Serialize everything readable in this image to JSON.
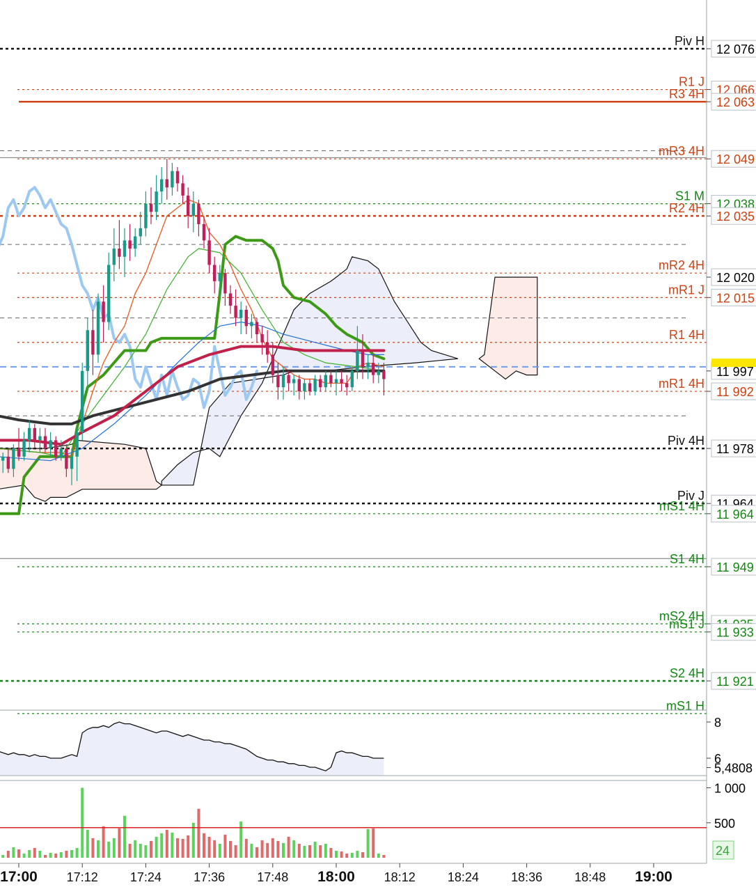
{
  "chart_data": {
    "type": "candlestick",
    "title": "",
    "price_axis": {
      "range": [
        11912,
        12085
      ],
      "tick_labels": [
        {
          "value": 12076,
          "text": "12 076",
          "color": "#000000",
          "box": "#ffffff"
        },
        {
          "value": 12066,
          "text": "12 066",
          "color": "#d04010",
          "box": "#ffffff"
        },
        {
          "value": 12063,
          "text": "12 063",
          "color": "#d04010",
          "box": "#ffffff"
        },
        {
          "value": 12049,
          "text": "12 049",
          "color": "#d04010",
          "box": "#ffffff"
        },
        {
          "value": 12038,
          "text": "12 038",
          "color": "#118811",
          "box": "#ffffff"
        },
        {
          "value": 12035,
          "text": "12 035",
          "color": "#d04010",
          "box": "#ffffff"
        },
        {
          "value": 12020,
          "text": "12 020",
          "color": "#000000",
          "box": "#ffffff"
        },
        {
          "value": 12015,
          "text": "12 015",
          "color": "#d04010",
          "box": "#ffffff"
        },
        {
          "value": 11997,
          "text": "11 997",
          "color": "#000000",
          "box": "#ffffff"
        },
        {
          "value": 11992,
          "text": "11 992",
          "color": "#d04010",
          "box": "#ffffff"
        },
        {
          "value": 11978,
          "text": "11 978",
          "color": "#000000",
          "box": "#ffffff"
        },
        {
          "value": 11964.5,
          "text": "11 964",
          "color": "#000000",
          "box": "#ffffff"
        },
        {
          "value": 11962,
          "text": "11 964",
          "color": "#118811",
          "box": "#ffffff"
        },
        {
          "value": 11949,
          "text": "11 949",
          "color": "#118811",
          "box": "#ffffff"
        },
        {
          "value": 11935,
          "text": "11 935",
          "color": "#118811",
          "box": "#ffffff"
        },
        {
          "value": 11933,
          "text": "11 933",
          "color": "#118811",
          "box": "#ffffff"
        },
        {
          "value": 11921,
          "text": "11 921",
          "color": "#118811",
          "box": "#ffffff"
        }
      ]
    },
    "time_axis": {
      "tick_labels": [
        "17:00",
        "17:12",
        "17:24",
        "17:36",
        "17:48",
        "18:00",
        "18:12",
        "18:24",
        "18:36",
        "18:48",
        "19:00"
      ],
      "bold_labels": [
        "17:00",
        "18:00",
        "19:00"
      ],
      "start": "16:56",
      "end": "19:04"
    },
    "pivot_levels": [
      {
        "label": "Piv H",
        "value": 12076,
        "color": "#111111",
        "style": "dotted-bold"
      },
      {
        "label": "R1 J",
        "value": 12066,
        "color": "#d04010",
        "style": "dotted"
      },
      {
        "label": "R3 4H",
        "value": 12063,
        "color": "#d04010",
        "style": "solid"
      },
      {
        "label": "mR3 4H",
        "value": 12049,
        "color": "#d04010",
        "style": "dotted"
      },
      {
        "label": "S1 M",
        "value": 12038,
        "color": "#118811",
        "style": "dotted"
      },
      {
        "label": "R2 4H",
        "value": 12035,
        "color": "#d04010",
        "style": "dotted-bold"
      },
      {
        "label": "mR2 4H",
        "value": 12021,
        "color": "#d04010",
        "style": "dotted"
      },
      {
        "label": "mR1 J",
        "value": 12015,
        "color": "#d04010",
        "style": "dotted"
      },
      {
        "label": "R1 4H",
        "value": 12004,
        "color": "#d04010",
        "style": "dotted"
      },
      {
        "label": "mR1 4H",
        "value": 11992,
        "color": "#d04010",
        "style": "dotted"
      },
      {
        "label": "Piv 4H",
        "value": 11978,
        "color": "#111111",
        "style": "dotted-bold"
      },
      {
        "label": "Piv J",
        "value": 11964.5,
        "color": "#111111",
        "style": "dotted-bold"
      },
      {
        "label": "mS1 4H",
        "value": 11962,
        "color": "#118811",
        "style": "dotted"
      },
      {
        "label": "S1 4H",
        "value": 11949,
        "color": "#118811",
        "style": "dotted"
      },
      {
        "label": "mS2 4H",
        "value": 11935,
        "color": "#118811",
        "style": "dotted"
      },
      {
        "label": "mS1 J",
        "value": 11933,
        "color": "#118811",
        "style": "dotted"
      },
      {
        "label": "S2 4H",
        "value": 11921,
        "color": "#118811",
        "style": "dotted-bold"
      },
      {
        "label": "mS1 H",
        "value": 11913,
        "color": "#118811",
        "style": "dotted"
      }
    ],
    "candles": [
      {
        "t": "16:56",
        "o": 11978,
        "h": 11979,
        "l": 11973,
        "c": 11975
      },
      {
        "t": "16:57",
        "o": 11975,
        "h": 11977,
        "l": 11972,
        "c": 11976
      },
      {
        "t": "16:58",
        "o": 11976,
        "h": 11978,
        "l": 11972,
        "c": 11973
      },
      {
        "t": "16:59",
        "o": 11973,
        "h": 11979,
        "l": 11971,
        "c": 11978
      },
      {
        "t": "17:00",
        "o": 11978,
        "h": 11983,
        "l": 11975,
        "c": 11976
      },
      {
        "t": "17:01",
        "o": 11976,
        "h": 11982,
        "l": 11975,
        "c": 11980
      },
      {
        "t": "17:02",
        "o": 11980,
        "h": 11985,
        "l": 11977,
        "c": 11983
      },
      {
        "t": "17:03",
        "o": 11983,
        "h": 11984,
        "l": 11978,
        "c": 11980
      },
      {
        "t": "17:04",
        "o": 11980,
        "h": 11983,
        "l": 11977,
        "c": 11981
      },
      {
        "t": "17:05",
        "o": 11981,
        "h": 11983,
        "l": 11977,
        "c": 11978
      },
      {
        "t": "17:06",
        "o": 11978,
        "h": 11982,
        "l": 11976,
        "c": 11980
      },
      {
        "t": "17:07",
        "o": 11980,
        "h": 11981,
        "l": 11975,
        "c": 11976
      },
      {
        "t": "17:08",
        "o": 11976,
        "h": 11980,
        "l": 11975,
        "c": 11978
      },
      {
        "t": "17:09",
        "o": 11978,
        "h": 11979,
        "l": 11971,
        "c": 11973
      },
      {
        "t": "17:10",
        "o": 11973,
        "h": 11978,
        "l": 11969,
        "c": 11976
      },
      {
        "t": "17:11",
        "o": 11976,
        "h": 11983,
        "l": 11970,
        "c": 11982
      },
      {
        "t": "17:12",
        "o": 11982,
        "h": 11999,
        "l": 11980,
        "c": 11997
      },
      {
        "t": "17:13",
        "o": 11997,
        "h": 12010,
        "l": 11992,
        "c": 12007
      },
      {
        "t": "17:14",
        "o": 12007,
        "h": 12012,
        "l": 11996,
        "c": 12001
      },
      {
        "t": "17:15",
        "o": 12001,
        "h": 12016,
        "l": 11999,
        "c": 12014
      },
      {
        "t": "17:16",
        "o": 12014,
        "h": 12018,
        "l": 12004,
        "c": 12009
      },
      {
        "t": "17:17",
        "o": 12009,
        "h": 12026,
        "l": 12007,
        "c": 12023
      },
      {
        "t": "17:18",
        "o": 12023,
        "h": 12032,
        "l": 12019,
        "c": 12027
      },
      {
        "t": "17:19",
        "o": 12027,
        "h": 12034,
        "l": 12022,
        "c": 12025
      },
      {
        "t": "17:20",
        "o": 12025,
        "h": 12032,
        "l": 12020,
        "c": 12029
      },
      {
        "t": "17:21",
        "o": 12029,
        "h": 12033,
        "l": 12024,
        "c": 12027
      },
      {
        "t": "17:22",
        "o": 12027,
        "h": 12032,
        "l": 12025,
        "c": 12030
      },
      {
        "t": "17:23",
        "o": 12030,
        "h": 12036,
        "l": 12028,
        "c": 12032
      },
      {
        "t": "17:24",
        "o": 12032,
        "h": 12041,
        "l": 12030,
        "c": 12038
      },
      {
        "t": "17:25",
        "o": 12038,
        "h": 12042,
        "l": 12033,
        "c": 12036
      },
      {
        "t": "17:26",
        "o": 12036,
        "h": 12045,
        "l": 12034,
        "c": 12041
      },
      {
        "t": "17:27",
        "o": 12041,
        "h": 12047,
        "l": 12038,
        "c": 12044
      },
      {
        "t": "17:28",
        "o": 12044,
        "h": 12049,
        "l": 12039,
        "c": 12042
      },
      {
        "t": "17:29",
        "o": 12042,
        "h": 12048,
        "l": 12040,
        "c": 12046
      },
      {
        "t": "17:30",
        "o": 12046,
        "h": 12047,
        "l": 12041,
        "c": 12043
      },
      {
        "t": "17:31",
        "o": 12043,
        "h": 12045,
        "l": 12038,
        "c": 12040
      },
      {
        "t": "17:32",
        "o": 12040,
        "h": 12042,
        "l": 12032,
        "c": 12035
      },
      {
        "t": "17:33",
        "o": 12035,
        "h": 12041,
        "l": 12031,
        "c": 12038
      },
      {
        "t": "17:34",
        "o": 12038,
        "h": 12039,
        "l": 12030,
        "c": 12033
      },
      {
        "t": "17:35",
        "o": 12033,
        "h": 12035,
        "l": 12027,
        "c": 12029
      },
      {
        "t": "17:36",
        "o": 12029,
        "h": 12032,
        "l": 12021,
        "c": 12023
      },
      {
        "t": "17:37",
        "o": 12023,
        "h": 12025,
        "l": 12016,
        "c": 12019
      },
      {
        "t": "17:38",
        "o": 12019,
        "h": 12023,
        "l": 12015,
        "c": 12021
      },
      {
        "t": "17:39",
        "o": 12021,
        "h": 12022,
        "l": 12013,
        "c": 12016
      },
      {
        "t": "17:40",
        "o": 12016,
        "h": 12018,
        "l": 12011,
        "c": 12013
      },
      {
        "t": "17:41",
        "o": 12013,
        "h": 12017,
        "l": 12008,
        "c": 12010
      },
      {
        "t": "17:42",
        "o": 12010,
        "h": 12014,
        "l": 12006,
        "c": 12012
      },
      {
        "t": "17:43",
        "o": 12012,
        "h": 12013,
        "l": 12006,
        "c": 12008
      },
      {
        "t": "17:44",
        "o": 12008,
        "h": 12011,
        "l": 12005,
        "c": 12009
      },
      {
        "t": "17:45",
        "o": 12009,
        "h": 12010,
        "l": 12004,
        "c": 12006
      },
      {
        "t": "17:46",
        "o": 12006,
        "h": 12008,
        "l": 12001,
        "c": 12004
      },
      {
        "t": "17:47",
        "o": 12004,
        "h": 12007,
        "l": 11999,
        "c": 12001
      },
      {
        "t": "17:48",
        "o": 12001,
        "h": 12004,
        "l": 11994,
        "c": 11996
      },
      {
        "t": "17:49",
        "o": 11996,
        "h": 11999,
        "l": 11990,
        "c": 11993
      },
      {
        "t": "17:50",
        "o": 11993,
        "h": 11998,
        "l": 11990,
        "c": 11996
      },
      {
        "t": "17:51",
        "o": 11996,
        "h": 11997,
        "l": 11992,
        "c": 11994
      },
      {
        "t": "17:52",
        "o": 11994,
        "h": 11996,
        "l": 11991,
        "c": 11995
      },
      {
        "t": "17:53",
        "o": 11995,
        "h": 11996,
        "l": 11990,
        "c": 11992
      },
      {
        "t": "17:54",
        "o": 11992,
        "h": 11995,
        "l": 11990,
        "c": 11994
      },
      {
        "t": "17:55",
        "o": 11994,
        "h": 11995,
        "l": 11991,
        "c": 11992
      },
      {
        "t": "17:56",
        "o": 11992,
        "h": 11996,
        "l": 11991,
        "c": 11995
      },
      {
        "t": "17:57",
        "o": 11995,
        "h": 11996,
        "l": 11992,
        "c": 11993
      },
      {
        "t": "17:58",
        "o": 11993,
        "h": 11997,
        "l": 11992,
        "c": 11996
      },
      {
        "t": "17:59",
        "o": 11996,
        "h": 11997,
        "l": 11993,
        "c": 11994
      },
      {
        "t": "18:00",
        "o": 11994,
        "h": 11997,
        "l": 11991,
        "c": 11995
      },
      {
        "t": "18:01",
        "o": 11995,
        "h": 11997,
        "l": 11992,
        "c": 11994
      },
      {
        "t": "18:02",
        "o": 11994,
        "h": 11996,
        "l": 11991,
        "c": 11993
      },
      {
        "t": "18:03",
        "o": 11993,
        "h": 11998,
        "l": 11992,
        "c": 11997
      },
      {
        "t": "18:04",
        "o": 11997,
        "h": 12008,
        "l": 11995,
        "c": 12002
      },
      {
        "t": "18:05",
        "o": 12002,
        "h": 12006,
        "l": 11995,
        "c": 11998
      },
      {
        "t": "18:06",
        "o": 11998,
        "h": 12001,
        "l": 11995,
        "c": 11999
      },
      {
        "t": "18:07",
        "o": 11999,
        "h": 12001,
        "l": 11994,
        "c": 11996
      },
      {
        "t": "18:08",
        "o": 11996,
        "h": 11999,
        "l": 11994,
        "c": 11997
      },
      {
        "t": "18:09",
        "o": 11997,
        "h": 11999,
        "l": 11991,
        "c": 11995
      }
    ],
    "bull_color": "#1a9b8a",
    "bear_color": "#c0205a",
    "indicator": {
      "tick_labels": [
        "8",
        "6",
        "5,4808"
      ],
      "values": [
        6.4,
        6.3,
        6.2,
        6.3,
        6.2,
        6.2,
        6.1,
        6.2,
        6.1,
        6.1,
        6.0,
        6.0,
        6.0,
        6.1,
        6.2,
        6.1,
        7.4,
        7.6,
        7.7,
        7.7,
        7.8,
        7.7,
        7.9,
        8.0,
        7.9,
        7.9,
        7.8,
        7.7,
        7.6,
        7.5,
        7.4,
        7.5,
        7.5,
        7.4,
        7.3,
        7.2,
        7.3,
        7.2,
        7.1,
        7.0,
        7.0,
        6.9,
        6.9,
        6.8,
        6.8,
        6.7,
        6.6,
        6.5,
        6.3,
        6.1,
        6.0,
        5.9,
        5.9,
        5.8,
        5.8,
        5.7,
        5.7,
        5.6,
        5.6,
        5.5,
        5.5,
        5.4,
        5.3,
        5.5,
        6.3,
        6.4,
        6.3,
        6.3,
        6.2,
        6.1,
        6.1,
        6.0,
        6.0,
        6.0
      ]
    },
    "volume": {
      "tick_labels": [
        "1 000",
        "500"
      ],
      "last_label": "24",
      "threshold": 430,
      "values": [
        60,
        40,
        100,
        150,
        120,
        60,
        110,
        140,
        100,
        40,
        70,
        60,
        80,
        100,
        110,
        140,
        1000,
        400,
        280,
        250,
        450,
        230,
        280,
        420,
        600,
        200,
        250,
        200,
        180,
        240,
        300,
        350,
        400,
        360,
        280,
        270,
        320,
        500,
        700,
        350,
        300,
        250,
        200,
        330,
        240,
        180,
        520,
        270,
        200,
        150,
        250,
        210,
        280,
        240,
        210,
        300,
        250,
        200,
        170,
        180,
        230,
        180,
        200,
        140,
        100,
        90,
        60,
        70,
        100,
        80,
        410,
        420,
        60,
        40,
        30
      ]
    }
  }
}
